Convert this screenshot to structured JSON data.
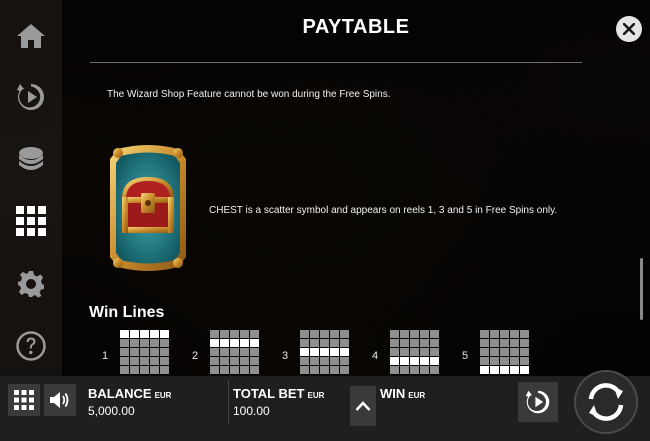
{
  "panel": {
    "title": "PAYTABLE",
    "wizard_note": "The Wizard Shop Feature cannot be won during the Free Spins.",
    "chest_description": "CHEST is a scatter symbol and appears on reels 1, 3 and 5 in Free Spins only.",
    "win_lines_title": "Win Lines"
  },
  "nav": {
    "items": [
      {
        "name": "home-icon"
      },
      {
        "name": "replay-icon"
      },
      {
        "name": "coins-icon"
      },
      {
        "name": "paytable-grid-icon",
        "active": true
      },
      {
        "name": "settings-gear-icon"
      },
      {
        "name": "help-icon"
      }
    ]
  },
  "win_lines": [
    {
      "number": "1",
      "active_row": 0
    },
    {
      "number": "2",
      "active_row": 1
    },
    {
      "number": "3",
      "active_row": 2
    },
    {
      "number": "4",
      "active_row": 3
    },
    {
      "number": "5",
      "active_row": 4
    }
  ],
  "bottom_bar": {
    "balance_label": "BALANCE",
    "balance_currency": "EUR",
    "balance_value": "5,000.00",
    "total_bet_label": "TOTAL BET",
    "total_bet_currency": "EUR",
    "total_bet_value": "100.00",
    "win_label": "WIN",
    "win_currency": "EUR"
  }
}
